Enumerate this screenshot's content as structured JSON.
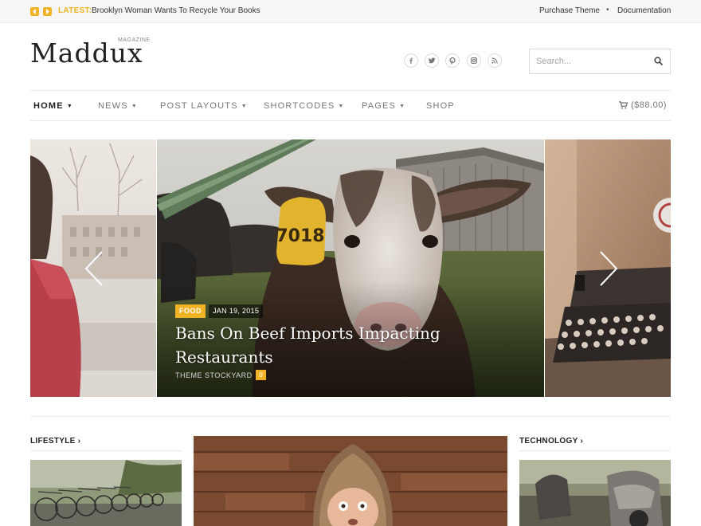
{
  "topbar": {
    "latest_label": "LATEST:",
    "headline": "Brooklyn Woman Wants To Recycle Your Books",
    "links": [
      "Purchase Theme",
      "Documentation"
    ],
    "separator": "•"
  },
  "header": {
    "logo": "Maddux",
    "logo_sub": "MAGAZINE",
    "social_icons": [
      "facebook-icon",
      "twitter-icon",
      "pinterest-icon",
      "instagram-icon",
      "rss-icon"
    ],
    "search_placeholder": "Search..."
  },
  "nav": {
    "items": [
      {
        "label": "HOME",
        "caret": "▼",
        "active": true
      },
      {
        "label": "NEWS",
        "caret": "▼"
      },
      {
        "label": "POST LAYOUTS",
        "caret": "▼"
      },
      {
        "label": "SHORTCODES",
        "caret": "▼"
      },
      {
        "label": "PAGES",
        "caret": "▼"
      },
      {
        "label": "SHOP",
        "caret": ""
      }
    ],
    "cart": "($88.00)"
  },
  "slider": {
    "category": "FOOD",
    "date": "JAN 19, 2015",
    "title": "Bans On Beef Imports Impacting Restaurants",
    "author": "THEME STOCKYARD",
    "comments": "0"
  },
  "sections": {
    "left": "LIFESTYLE ›",
    "right": "TECHNOLOGY ›"
  },
  "colors": {
    "accent": "#f0b325",
    "text": "#222222",
    "muted": "#777777"
  }
}
